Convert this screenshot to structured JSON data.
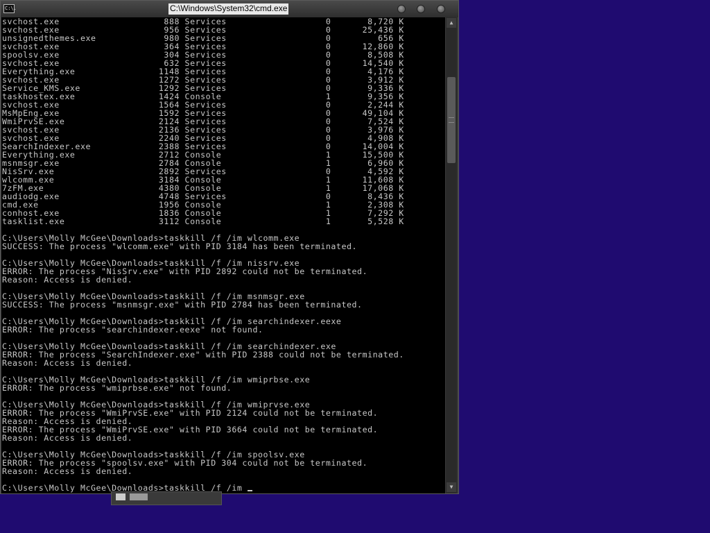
{
  "window": {
    "title": "C:\\Windows\\System32\\cmd.exe",
    "app_icon_label": "C:\\.",
    "minimize_label": "",
    "maximize_label": "",
    "close_label": ""
  },
  "console": {
    "process_rows": [
      {
        "name": "svchost.exe",
        "pid": "888",
        "session": "Services",
        "num": "0",
        "mem": "8,720 K"
      },
      {
        "name": "svchost.exe",
        "pid": "956",
        "session": "Services",
        "num": "0",
        "mem": "25,436 K"
      },
      {
        "name": "unsignedthemes.exe",
        "pid": "980",
        "session": "Services",
        "num": "0",
        "mem": "656 K"
      },
      {
        "name": "svchost.exe",
        "pid": "364",
        "session": "Services",
        "num": "0",
        "mem": "12,860 K"
      },
      {
        "name": "spoolsv.exe",
        "pid": "304",
        "session": "Services",
        "num": "0",
        "mem": "8,508 K"
      },
      {
        "name": "svchost.exe",
        "pid": "632",
        "session": "Services",
        "num": "0",
        "mem": "14,540 K"
      },
      {
        "name": "Everything.exe",
        "pid": "1148",
        "session": "Services",
        "num": "0",
        "mem": "4,176 K"
      },
      {
        "name": "svchost.exe",
        "pid": "1272",
        "session": "Services",
        "num": "0",
        "mem": "3,912 K"
      },
      {
        "name": "Service_KMS.exe",
        "pid": "1292",
        "session": "Services",
        "num": "0",
        "mem": "9,336 K"
      },
      {
        "name": "taskhostex.exe",
        "pid": "1424",
        "session": "Console",
        "num": "1",
        "mem": "9,356 K"
      },
      {
        "name": "svchost.exe",
        "pid": "1564",
        "session": "Services",
        "num": "0",
        "mem": "2,244 K"
      },
      {
        "name": "MsMpEng.exe",
        "pid": "1592",
        "session": "Services",
        "num": "0",
        "mem": "49,104 K"
      },
      {
        "name": "WmiPrvSE.exe",
        "pid": "2124",
        "session": "Services",
        "num": "0",
        "mem": "7,524 K"
      },
      {
        "name": "svchost.exe",
        "pid": "2136",
        "session": "Services",
        "num": "0",
        "mem": "3,976 K"
      },
      {
        "name": "svchost.exe",
        "pid": "2240",
        "session": "Services",
        "num": "0",
        "mem": "4,908 K"
      },
      {
        "name": "SearchIndexer.exe",
        "pid": "2388",
        "session": "Services",
        "num": "0",
        "mem": "14,004 K"
      },
      {
        "name": "Everything.exe",
        "pid": "2712",
        "session": "Console",
        "num": "1",
        "mem": "15,500 K"
      },
      {
        "name": "msnmsgr.exe",
        "pid": "2784",
        "session": "Console",
        "num": "1",
        "mem": "6,960 K"
      },
      {
        "name": "NisSrv.exe",
        "pid": "2892",
        "session": "Services",
        "num": "0",
        "mem": "4,592 K"
      },
      {
        "name": "wlcomm.exe",
        "pid": "3184",
        "session": "Console",
        "num": "1",
        "mem": "11,608 K"
      },
      {
        "name": "7zFM.exe",
        "pid": "4380",
        "session": "Console",
        "num": "1",
        "mem": "17,068 K"
      },
      {
        "name": "audiodg.exe",
        "pid": "4748",
        "session": "Services",
        "num": "0",
        "mem": "8,436 K"
      },
      {
        "name": "cmd.exe",
        "pid": "1956",
        "session": "Console",
        "num": "1",
        "mem": "2,308 K"
      },
      {
        "name": "conhost.exe",
        "pid": "1836",
        "session": "Console",
        "num": "1",
        "mem": "7,292 K"
      },
      {
        "name": "tasklist.exe",
        "pid": "3112",
        "session": "Console",
        "num": "1",
        "mem": "5,528 K"
      }
    ],
    "output_lines": [
      "",
      "C:\\Users\\Molly McGee\\Downloads>taskkill /f /im wlcomm.exe",
      "SUCCESS: The process \"wlcomm.exe\" with PID 3184 has been terminated.",
      "",
      "C:\\Users\\Molly McGee\\Downloads>taskkill /f /im nissrv.exe",
      "ERROR: The process \"NisSrv.exe\" with PID 2892 could not be terminated.",
      "Reason: Access is denied.",
      "",
      "C:\\Users\\Molly McGee\\Downloads>taskkill /f /im msnmsgr.exe",
      "SUCCESS: The process \"msnmsgr.exe\" with PID 2784 has been terminated.",
      "",
      "C:\\Users\\Molly McGee\\Downloads>taskkill /f /im searchindexer.eexe",
      "ERROR: The process \"searchindexer.eexe\" not found.",
      "",
      "C:\\Users\\Molly McGee\\Downloads>taskkill /f /im searchindexer.exe",
      "ERROR: The process \"SearchIndexer.exe\" with PID 2388 could not be terminated.",
      "Reason: Access is denied.",
      "",
      "C:\\Users\\Molly McGee\\Downloads>taskkill /f /im wmiprbse.exe",
      "ERROR: The process \"wmiprbse.exe\" not found.",
      "",
      "C:\\Users\\Molly McGee\\Downloads>taskkill /f /im wmiprvse.exe",
      "ERROR: The process \"WmiPrvSE.exe\" with PID 2124 could not be terminated.",
      "Reason: Access is denied.",
      "ERROR: The process \"WmiPrvSE.exe\" with PID 3664 could not be terminated.",
      "Reason: Access is denied.",
      "",
      "C:\\Users\\Molly McGee\\Downloads>taskkill /f /im spoolsv.exe",
      "ERROR: The process \"spoolsv.exe\" with PID 304 could not be terminated.",
      "Reason: Access is denied.",
      ""
    ],
    "current_prompt": "C:\\Users\\Molly McGee\\Downloads>taskkill /f /im "
  },
  "scrollbar": {
    "up_arrow_icon": "triangle-up-icon",
    "down_arrow_icon": "triangle-down-icon"
  },
  "colors": {
    "desktop_background": "#1f0b70",
    "console_background": "#000000",
    "console_text": "#c8c8c8"
  }
}
